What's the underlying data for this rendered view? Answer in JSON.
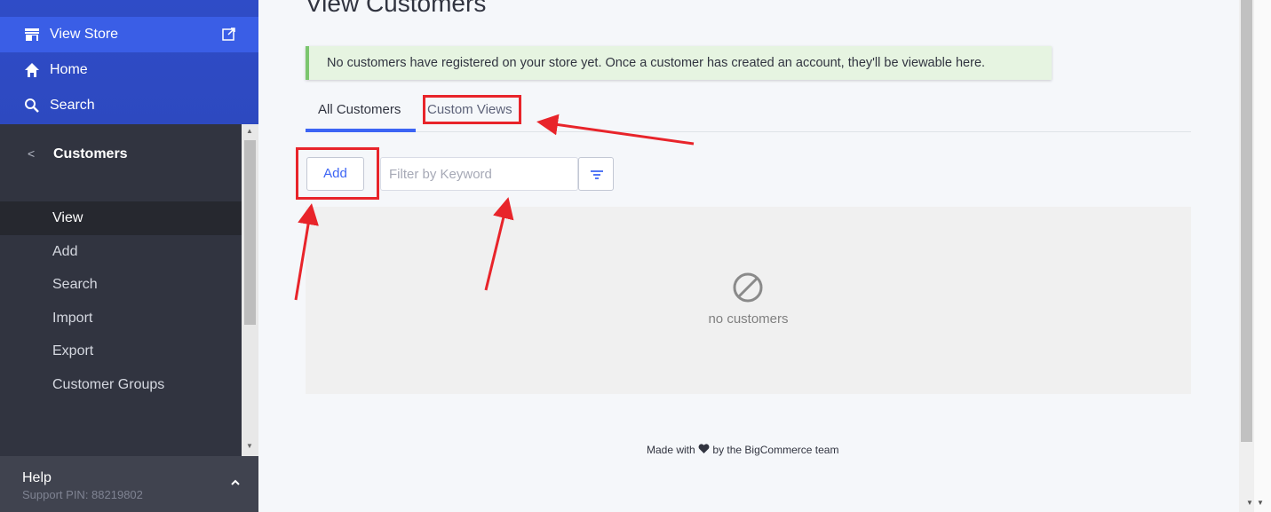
{
  "sidebar": {
    "top": {
      "view_store": "View Store",
      "home": "Home",
      "search": "Search"
    },
    "section_title": "Customers",
    "items": [
      {
        "label": "View",
        "active": true
      },
      {
        "label": "Add"
      },
      {
        "label": "Search"
      },
      {
        "label": "Import"
      },
      {
        "label": "Export"
      },
      {
        "label": "Customer Groups"
      }
    ],
    "help": {
      "title": "Help",
      "pin": "Support PIN: 88219802"
    }
  },
  "main": {
    "title": "View Customers",
    "alert": "No customers have registered on your store yet. Once a customer has created an account, they'll be viewable here.",
    "tabs": [
      {
        "label": "All Customers",
        "active": true
      },
      {
        "label": "Custom Views"
      }
    ],
    "add_label": "Add",
    "filter_placeholder": "Filter by Keyword",
    "empty_text": "no customers",
    "footer_prefix": "Made with",
    "footer_suffix": "by the BigCommerce team"
  },
  "colors": {
    "accent": "#3c64f4",
    "annotation": "#e8242a",
    "sidebar_bg": "#313440",
    "alert_bg": "#e6f4e1"
  }
}
